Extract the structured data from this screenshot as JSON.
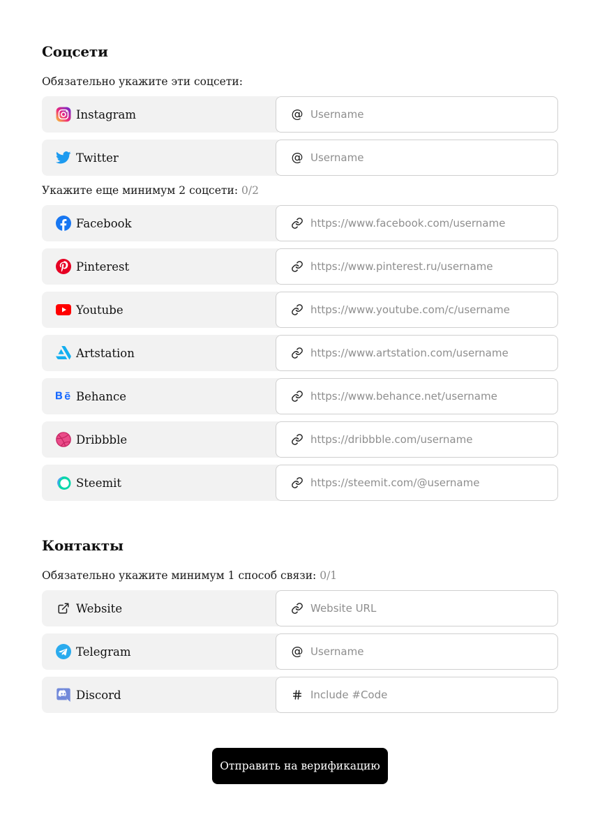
{
  "socials": {
    "title": "Соцсети",
    "required_caption": "Обязательно укажите эти соцсети:",
    "required": [
      {
        "icon": "instagram-icon",
        "label": "Instagram",
        "prefix_icon": "at-icon",
        "placeholder": "Username",
        "value": ""
      },
      {
        "icon": "twitter-icon",
        "label": "Twitter",
        "prefix_icon": "at-icon",
        "placeholder": "Username",
        "value": ""
      }
    ],
    "optional_caption": "Укажите еще минимум 2 соцсети:",
    "optional_counter": "0/2",
    "optional": [
      {
        "icon": "facebook-icon",
        "label": "Facebook",
        "prefix_icon": "link-icon",
        "placeholder": "https://www.facebook.com/username",
        "value": ""
      },
      {
        "icon": "pinterest-icon",
        "label": "Pinterest",
        "prefix_icon": "link-icon",
        "placeholder": "https://www.pinterest.ru/username",
        "value": ""
      },
      {
        "icon": "youtube-icon",
        "label": "Youtube",
        "prefix_icon": "link-icon",
        "placeholder": "https://www.youtube.com/c/username",
        "value": ""
      },
      {
        "icon": "artstation-icon",
        "label": "Artstation",
        "prefix_icon": "link-icon",
        "placeholder": "https://www.artstation.com/username",
        "value": ""
      },
      {
        "icon": "behance-icon",
        "label": "Behance",
        "prefix_icon": "link-icon",
        "placeholder": "https://www.behance.net/username",
        "value": ""
      },
      {
        "icon": "dribbble-icon",
        "label": "Dribbble",
        "prefix_icon": "link-icon",
        "placeholder": "https://dribbble.com/username",
        "value": ""
      },
      {
        "icon": "steemit-icon",
        "label": "Steemit",
        "prefix_icon": "link-icon",
        "placeholder": "https://steemit.com/@username",
        "value": ""
      }
    ]
  },
  "contacts": {
    "title": "Контакты",
    "caption": "Обязательно укажите минимум 1 способ связи:",
    "counter": "0/1",
    "items": [
      {
        "icon": "external-link-icon",
        "label": "Website",
        "prefix_icon": "link-icon",
        "placeholder": "Website URL",
        "value": ""
      },
      {
        "icon": "telegram-icon",
        "label": "Telegram",
        "prefix_icon": "at-icon",
        "placeholder": "Username",
        "value": ""
      },
      {
        "icon": "discord-icon",
        "label": "Discord",
        "prefix_icon": "hash-icon",
        "placeholder": "Include #Code",
        "value": ""
      }
    ]
  },
  "submit_label": "Отправить на верификацию",
  "colors": {
    "label_bg": "#f2f2f2",
    "field_border": "#cfcfcf",
    "placeholder": "#8e8e8e",
    "counter": "#8a8a8a",
    "button_bg": "#000000",
    "button_text": "#ffffff"
  }
}
